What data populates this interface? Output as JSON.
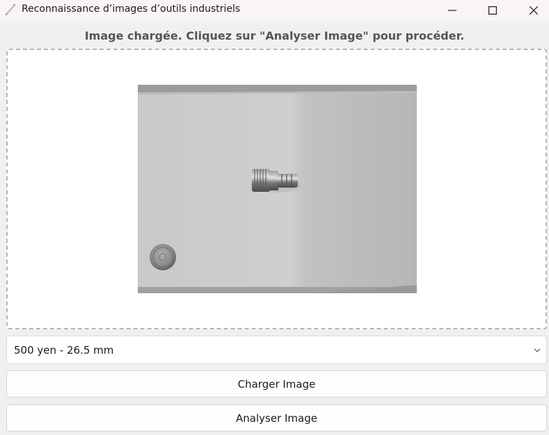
{
  "window": {
    "title": "Reconnaissance d’images d’outils industriels",
    "icons": {
      "app": "feather-icon",
      "minimize": "minimize-icon",
      "maximize": "maximize-icon",
      "close": "close-icon"
    }
  },
  "status": {
    "message": "Image chargée. Cliquez sur \"Analyser Image\" pour procéder."
  },
  "image_area": {
    "content": "grayscale photo of a threaded hose barb fitting next to a coin on white paper"
  },
  "reference_select": {
    "selected": "500 yen - 26.5 mm",
    "chevron_icon": "chevron-down-icon"
  },
  "buttons": {
    "load_label": "Charger Image",
    "analyze_label": "Analyser Image"
  },
  "colors": {
    "background": "#f0f0f0",
    "titlebar": "#faf5f4",
    "status_text": "#555555",
    "dashed_border": "#b5b5b5"
  }
}
